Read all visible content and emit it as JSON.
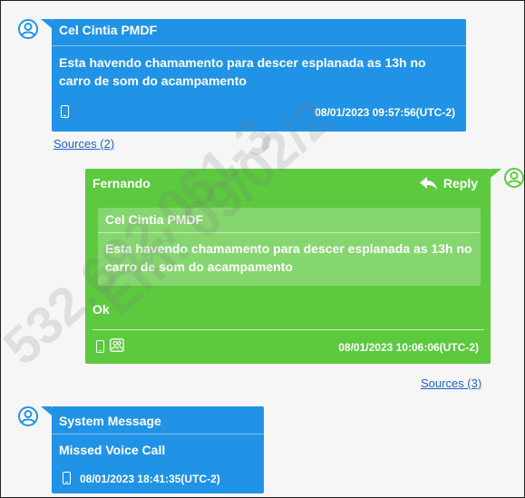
{
  "messages": [
    {
      "sender": "Cel Cintia PMDF",
      "text": "Esta havendo chamamento para descer esplanada as 13h no carro de som do acampamento",
      "timestamp": "08/01/2023 09:57:56(UTC-2)",
      "sources": "Sources (2)"
    },
    {
      "sender": "Fernando",
      "reply_label": "Reply",
      "quoted_sender": "Cel Cintia PMDF",
      "quoted_text": "Esta havendo chamamento para descer esplanada as 13h no carro de som do acampamento",
      "text": "Ok",
      "timestamp": "08/01/2023 10:06:06(UTC-2)",
      "sources": "Sources (3)"
    },
    {
      "sender": "System Message",
      "text": "Missed Voice Call",
      "timestamp": "08/01/2023 18:41:35(UTC-2)"
    }
  ],
  "watermark": {
    "line1": "532.692.061-3",
    "line2": "Em: 09/02/2"
  },
  "colors": {
    "incoming": "#2193e6",
    "outgoing": "#5cc93f",
    "link": "#1e63c9"
  }
}
